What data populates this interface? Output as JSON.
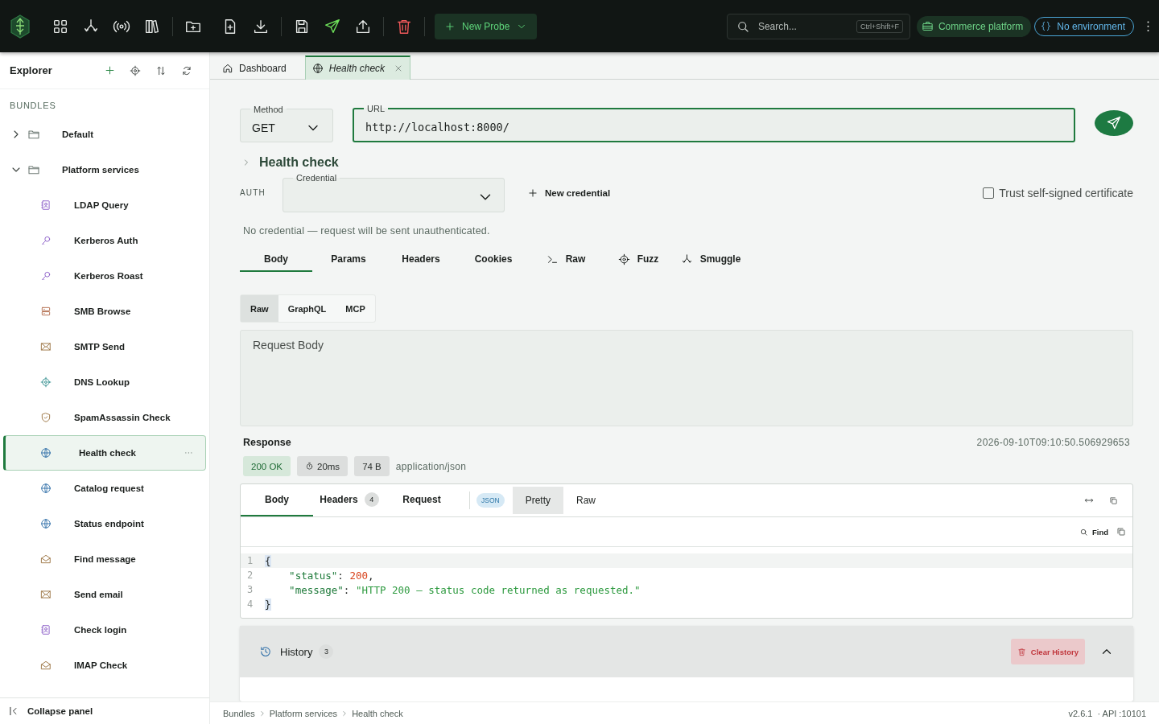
{
  "topbar": {
    "new_probe": "New Probe",
    "search": {
      "placeholder": "Search...",
      "shortcut": "Ctrl+Shift+F"
    },
    "workspace": "Commerce platform",
    "environment": "No environment"
  },
  "explorer": {
    "title": "Explorer",
    "section": "BUNDLES",
    "tree": [
      {
        "label": "Default",
        "expanded": false
      },
      {
        "label": "Platform services",
        "expanded": true,
        "children": [
          {
            "label": "LDAP Query",
            "kind": "contact",
            "selected": false
          },
          {
            "label": "Kerberos Auth",
            "kind": "key",
            "selected": false
          },
          {
            "label": "Kerberos Roast",
            "kind": "key",
            "selected": false
          },
          {
            "label": "SMB Browse",
            "kind": "server",
            "selected": false
          },
          {
            "label": "SMTP Send",
            "kind": "mail",
            "selected": false
          },
          {
            "label": "DNS Lookup",
            "kind": "target",
            "selected": false
          },
          {
            "label": "SpamAssassin Check",
            "kind": "shield",
            "selected": false
          },
          {
            "label": "Health check",
            "kind": "globe",
            "selected": true
          },
          {
            "label": "Catalog request",
            "kind": "globe",
            "selected": false
          },
          {
            "label": "Status endpoint",
            "kind": "globe",
            "selected": false
          },
          {
            "label": "Find message",
            "kind": "mailopen",
            "selected": false
          },
          {
            "label": "Send email",
            "kind": "mail",
            "selected": false
          },
          {
            "label": "Check login",
            "kind": "contact",
            "selected": false
          },
          {
            "label": "IMAP Check",
            "kind": "mailopen",
            "selected": false
          }
        ]
      }
    ],
    "collapse": "Collapse panel"
  },
  "tabs": [
    {
      "label": "Dashboard",
      "kind": "home",
      "selected": false
    },
    {
      "label": "Health check",
      "kind": "globe",
      "selected": true
    }
  ],
  "request": {
    "method_label": "Method",
    "method": "GET",
    "url_label": "URL",
    "url": "http://localhost:8000/",
    "name": "Health check",
    "auth_label": "AUTH",
    "credential_label": "Credential",
    "new_credential": "New credential",
    "trust": {
      "label": "Trust self-signed certificate",
      "checked": false
    },
    "auth_note": "No credential — request will be sent unauthenticated.",
    "tabs": [
      {
        "label": "Body",
        "kind": "text",
        "selected": true
      },
      {
        "label": "Params",
        "kind": "text",
        "selected": false
      },
      {
        "label": "Headers",
        "kind": "text",
        "selected": false
      },
      {
        "label": "Cookies",
        "kind": "text",
        "selected": false
      },
      {
        "label": "Raw",
        "kind": "terminal",
        "selected": false
      },
      {
        "label": "Fuzz",
        "kind": "target",
        "selected": false
      },
      {
        "label": "Smuggle",
        "kind": "branch",
        "selected": false
      }
    ],
    "body_modes": [
      {
        "label": "Raw",
        "selected": true
      },
      {
        "label": "GraphQL",
        "selected": false
      },
      {
        "label": "MCP",
        "selected": false
      }
    ],
    "body_placeholder": "Request Body"
  },
  "response": {
    "title": "Response",
    "timestamp": "2026-09-10T09:10:50.506929653",
    "status": "200 OK",
    "time": "20ms",
    "size": "74 B",
    "content_type": "application/json",
    "tabs": [
      {
        "label": "Body",
        "selected": true
      },
      {
        "label": "Headers",
        "count": "4",
        "selected": false
      },
      {
        "label": "Request",
        "selected": false
      }
    ],
    "format": "JSON",
    "views": [
      {
        "label": "Pretty",
        "selected": true
      },
      {
        "label": "Raw",
        "selected": false
      }
    ],
    "find": "Find",
    "lines": [
      {
        "number": "1",
        "tokens": [
          {
            "kind": "brace",
            "text": "{"
          }
        ]
      },
      {
        "number": "2",
        "tokens": [
          {
            "kind": "key",
            "text": "    \"status\""
          },
          {
            "kind": "punct",
            "text": ": "
          },
          {
            "kind": "number",
            "text": "200"
          },
          {
            "kind": "punct",
            "text": ","
          }
        ]
      },
      {
        "number": "3",
        "tokens": [
          {
            "kind": "key",
            "text": "    \"message\""
          },
          {
            "kind": "punct",
            "text": ": "
          },
          {
            "kind": "string",
            "text": "\"HTTP 200 — status code returned as requested.\""
          }
        ]
      },
      {
        "number": "4",
        "tokens": [
          {
            "kind": "brace",
            "text": "}"
          }
        ]
      }
    ]
  },
  "history": {
    "title": "History",
    "count": "3",
    "clear": "Clear History",
    "expanded": true
  },
  "status_bar": {
    "breadcrumbs": [
      "Bundles",
      "Platform services",
      "Health check"
    ],
    "version": "v2.6.1",
    "api": "· API :10101"
  }
}
